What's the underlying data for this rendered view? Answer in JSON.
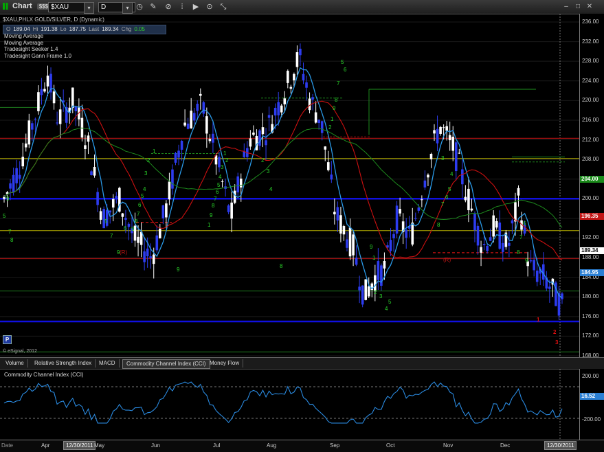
{
  "window": {
    "title": "Chart",
    "badge": "$$$",
    "symbol": "$XAU",
    "interval": "D"
  },
  "info": {
    "header": "$XAU,PHLX GOLD/SILVER, D (Dynamic)",
    "ohlc": [
      {
        "label": "O",
        "value": "189.04"
      },
      {
        "label": "Hi",
        "value": "191.38"
      },
      {
        "label": "Lo",
        "value": "187.75"
      },
      {
        "label": "Last",
        "value": "189.34"
      },
      {
        "label": "Chg",
        "value": "0.05"
      }
    ],
    "studies": [
      "Moving Average",
      "Moving Average",
      "Tradesight Seeker 1.4",
      "Tradesight Gann Frame 1.0"
    ]
  },
  "price_axis": {
    "labels": [
      "236.00",
      "232.00",
      "228.00",
      "224.00",
      "220.00",
      "216.00",
      "212.00",
      "208.00",
      "204.00",
      "200.00",
      "196.00",
      "192.00",
      "188.00",
      "184.00",
      "180.00",
      "176.00",
      "172.00",
      "168.00"
    ],
    "min": 168,
    "max": 236,
    "tags": [
      {
        "text": "204.00",
        "value": 204.0,
        "color": "#1a8a1a"
      },
      {
        "text": "196.35",
        "value": 196.35,
        "color": "#c21515"
      },
      {
        "text": "189.34",
        "value": 189.34,
        "color": "#ffffff"
      },
      {
        "text": "184.95",
        "value": 184.95,
        "color": "#2a7fd4"
      }
    ]
  },
  "p_button": "P",
  "esignal": "© eSignal, 2012",
  "tabs": [
    "Volume",
    "Relative Strength Index",
    "MACD",
    "Commodity Channel Index (CCI)",
    "Money Flow"
  ],
  "active_tab": 3,
  "cci": {
    "title": "Commodity Channel Index (CCI)",
    "axis_labels": [
      "200.00",
      "-200.00"
    ],
    "tag": "16.52",
    "tag_color": "#2a7fd4"
  },
  "date_axis": {
    "labels": [
      "Apr",
      "May",
      "Jun",
      "Jul",
      "Aug",
      "Sep",
      "Oct",
      "Nov",
      "Dec"
    ],
    "left_box": "12/30/2011",
    "right_box": "12/30/2011",
    "corner": "Date"
  },
  "chart_annotations": {
    "counts_green": [
      "5",
      "7",
      "8",
      "9",
      "9",
      "8",
      "7",
      "6",
      "5",
      "9",
      "1",
      "2",
      "3",
      "4",
      "5",
      "6",
      "7",
      "8",
      "9",
      "1",
      "2",
      "3",
      "4",
      "5",
      "6",
      "7",
      "8",
      "9",
      "1",
      "2",
      "3",
      "4",
      "5",
      "6",
      "7",
      "8",
      "9",
      "1",
      "2",
      "3",
      "4",
      "5",
      "6",
      "7",
      "8",
      "9",
      "1",
      "2",
      "3",
      "4",
      "5",
      "6",
      "7",
      "8",
      "9"
    ],
    "counts_red": [
      "1",
      "2",
      "3"
    ],
    "bracket_r": "(R)"
  },
  "colors": {
    "up_candle": "#ffffff",
    "down_candle": "#2d3cf0",
    "ma_fast": "#2a9ae8",
    "ma_slow_red": "#cc1010",
    "ma_slow_green": "#1d8a1d"
  }
}
